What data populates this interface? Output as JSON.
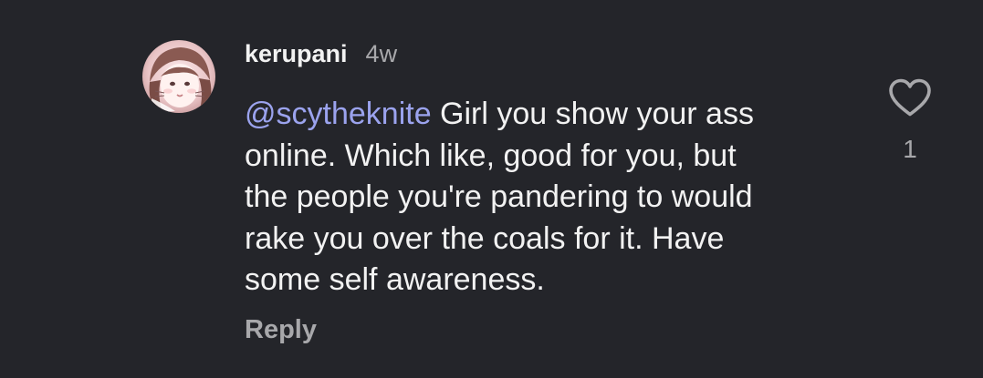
{
  "comment": {
    "username": "kerupani",
    "timestamp": "4w",
    "avatar_icon": "user-avatar-photo",
    "mention": "@scytheknite",
    "text_lines": [
      " Girl you show your ass",
      "online. Which like, good for you, but",
      "the people you're pandering to would",
      "rake you over the coals for it. Have",
      "some self awareness."
    ],
    "reply_label": "Reply",
    "like_icon": "heart-outline-icon",
    "like_count": "1"
  },
  "colors": {
    "background": "#24252a",
    "text": "#f2f2f2",
    "secondary_text": "#a8a8ab",
    "mention": "#9ba3ee"
  }
}
